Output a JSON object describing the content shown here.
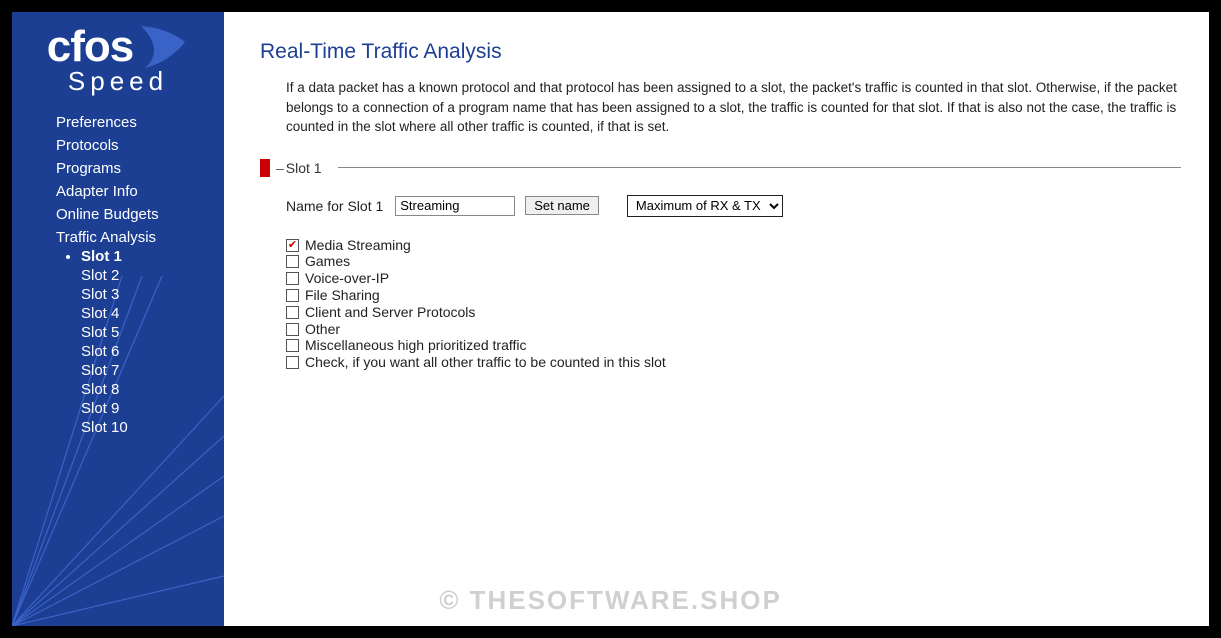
{
  "logo": {
    "top": "cfos",
    "bottom": "Speed"
  },
  "nav": {
    "items": [
      {
        "label": "Preferences"
      },
      {
        "label": "Protocols"
      },
      {
        "label": "Programs"
      },
      {
        "label": "Adapter Info"
      },
      {
        "label": "Online Budgets"
      },
      {
        "label": "Traffic Analysis"
      }
    ],
    "slots": [
      {
        "label": "Slot 1",
        "active": true
      },
      {
        "label": "Slot 2"
      },
      {
        "label": "Slot 3"
      },
      {
        "label": "Slot 4"
      },
      {
        "label": "Slot 5"
      },
      {
        "label": "Slot 6"
      },
      {
        "label": "Slot 7"
      },
      {
        "label": "Slot 8"
      },
      {
        "label": "Slot 9"
      },
      {
        "label": "Slot 10"
      }
    ]
  },
  "page": {
    "title": "Real-Time Traffic Analysis",
    "intro": "If a data packet has a known protocol and that protocol has been assigned to a slot, the packet's traffic is counted in that slot. Otherwise, if the packet belongs to a connection of a program name that has been assigned to a slot, the traffic is counted for that slot. If that is also not the case, the traffic is counted in the slot where all other traffic is counted, if that is set."
  },
  "slot": {
    "header_label": "Slot 1",
    "name_label": "Name for Slot 1",
    "name_value": "Streaming",
    "set_name_label": "Set name",
    "mode_options": [
      "Maximum of RX & TX"
    ],
    "mode_selected": "Maximum of RX & TX",
    "checks": [
      {
        "label": "Media Streaming",
        "checked": true
      },
      {
        "label": "Games",
        "checked": false
      },
      {
        "label": "Voice-over-IP",
        "checked": false
      },
      {
        "label": "File Sharing",
        "checked": false
      },
      {
        "label": "Client and Server Protocols",
        "checked": false
      },
      {
        "label": "Other",
        "checked": false
      },
      {
        "label": "Miscellaneous high prioritized traffic",
        "checked": false
      },
      {
        "label": "Check, if you want all other traffic to be counted in this slot",
        "checked": false
      }
    ]
  },
  "watermark": "© THESOFTWARE.SHOP"
}
